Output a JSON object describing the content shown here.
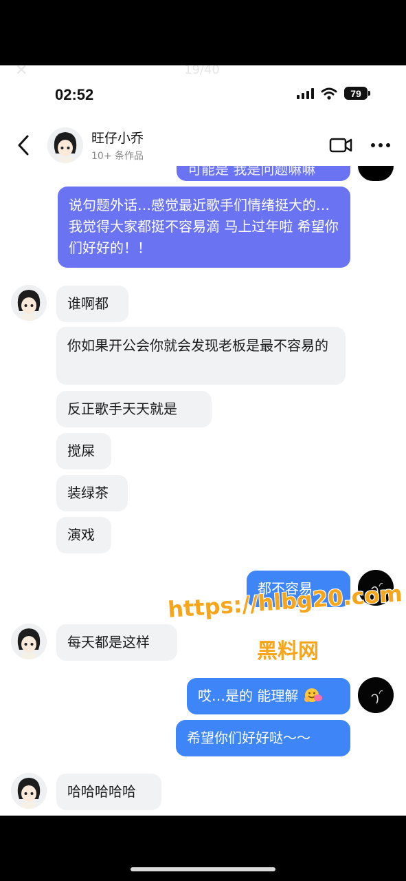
{
  "overlay": {
    "close_glyph": "✕",
    "counter": "19/40"
  },
  "status_bar": {
    "time": "02:52",
    "battery": "79"
  },
  "header": {
    "name": "旺仔小乔",
    "subtitle": "10+ 条作品"
  },
  "messages": {
    "clipped_top": "可能是 我是问题嘛嘛",
    "m1": "说句题外话…感觉最近歌手们情绪挺大的…我觉得大家都挺不容易滴 马上过年啦 希望你们好好的！！",
    "m2": "谁啊都",
    "m3": "你如果开公会你就会发现老板是最不容易的",
    "m4": "反正歌手天天就是",
    "m5": "搅屎",
    "m6": "装绿茶",
    "m7": "演戏",
    "m8": "都不容易…",
    "m9": "每天都是这样",
    "m10": "哎…是的 能理解",
    "m11": "希望你们好好哒～～",
    "m12": "哈哈哈哈哈"
  },
  "watermark": {
    "url": "https://hlbg20.com",
    "label": "黑料网"
  },
  "colors": {
    "outgoing_bubble": "#3e86f8",
    "outgoing_purple": "#6a73f1",
    "incoming_bubble": "#f1f2f4",
    "watermark": "#f7a51a"
  }
}
